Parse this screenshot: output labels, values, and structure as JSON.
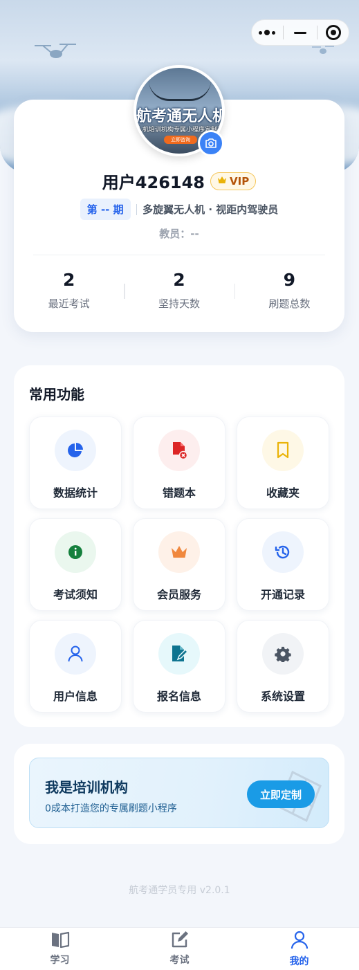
{
  "capsule": {
    "more_icon": "more-dots-icon",
    "minimize_icon": "minus-icon",
    "close_icon": "target-icon"
  },
  "avatar": {
    "title": "航考通无人机",
    "subtitle": "人机培训机构专属小程序定制开",
    "button_text": "立即咨询"
  },
  "profile": {
    "username": "用户426148",
    "vip": "VIP",
    "period": "第 -- 期",
    "course": "多旋翼无人机 · 视距内驾驶员",
    "instructor": "教员：--"
  },
  "stats": [
    {
      "value": "2",
      "label": "最近考试"
    },
    {
      "value": "2",
      "label": "坚持天数"
    },
    {
      "value": "9",
      "label": "刷题总数"
    }
  ],
  "functions": {
    "title": "常用功能",
    "items": [
      {
        "label": "数据统计",
        "icon": "pie-chart-icon",
        "color": "#2563eb",
        "bg": "#eef4fd"
      },
      {
        "label": "错题本",
        "icon": "wrong-doc-icon",
        "color": "#dc2626",
        "bg": "#fdeeee"
      },
      {
        "label": "收藏夹",
        "icon": "bookmark-icon",
        "color": "#eab308",
        "bg": "#fef8e6"
      },
      {
        "label": "考试须知",
        "icon": "info-icon",
        "color": "#15803d",
        "bg": "#eaf7ee"
      },
      {
        "label": "会员服务",
        "icon": "crown-icon",
        "color": "#f0883e",
        "bg": "#fef1e8"
      },
      {
        "label": "开通记录",
        "icon": "history-icon",
        "color": "#2563eb",
        "bg": "#eef4fd"
      },
      {
        "label": "用户信息",
        "icon": "user-icon",
        "color": "#2563eb",
        "bg": "#eef4fd"
      },
      {
        "label": "报名信息",
        "icon": "edit-doc-icon",
        "color": "#0e7490",
        "bg": "#e6f8fb"
      },
      {
        "label": "系统设置",
        "icon": "gear-icon",
        "color": "#4b5563",
        "bg": "#f1f3f6"
      }
    ]
  },
  "institution": {
    "title": "我是培训机构",
    "subtitle": "0成本打造您的专属刷题小程序",
    "button": "立即定制"
  },
  "version": "航考通学员专用 v2.0.1",
  "tabs": [
    {
      "label": "学习",
      "icon": "book-icon",
      "active": false
    },
    {
      "label": "考试",
      "icon": "edit-icon",
      "active": false
    },
    {
      "label": "我的",
      "icon": "user-icon",
      "active": true
    }
  ],
  "colors": {
    "accent": "#2563eb",
    "vip": "#eab308",
    "inst_button": "#1a9be6"
  }
}
